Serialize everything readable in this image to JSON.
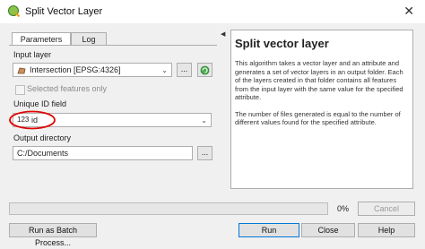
{
  "window": {
    "title": "Split Vector Layer",
    "close_icon": "close-icon"
  },
  "tabs": [
    {
      "label": "Parameters",
      "active": true
    },
    {
      "label": "Log",
      "active": false
    }
  ],
  "form": {
    "input_layer_label": "Input layer",
    "input_layer_value": "Intersection [EPSG:4326]",
    "selected_features_label": "Selected features only",
    "unique_id_label": "Unique ID field",
    "unique_id_type": "123",
    "unique_id_value": "id",
    "output_dir_label": "Output directory",
    "output_dir_value": "C:/Documents",
    "browse_label": "..."
  },
  "help": {
    "title": "Split vector layer",
    "p1": "This algorithm takes a vector layer and an attribute and generates a set of vector layers in an output folder. Each of the layers created in that folder contains all features from the input layer with the same value for the specified attribute.",
    "p2": "The number of files generated is equal to the number of different values found for the specified attribute."
  },
  "progress": {
    "percent_text": "0%",
    "value": 0
  },
  "buttons": {
    "cancel": "Cancel",
    "batch": "Run as Batch Process...",
    "run": "Run",
    "close": "Close",
    "help": "Help"
  },
  "colors": {
    "annotation": "#e00000",
    "iterate_icon": "#3a9a3a"
  }
}
